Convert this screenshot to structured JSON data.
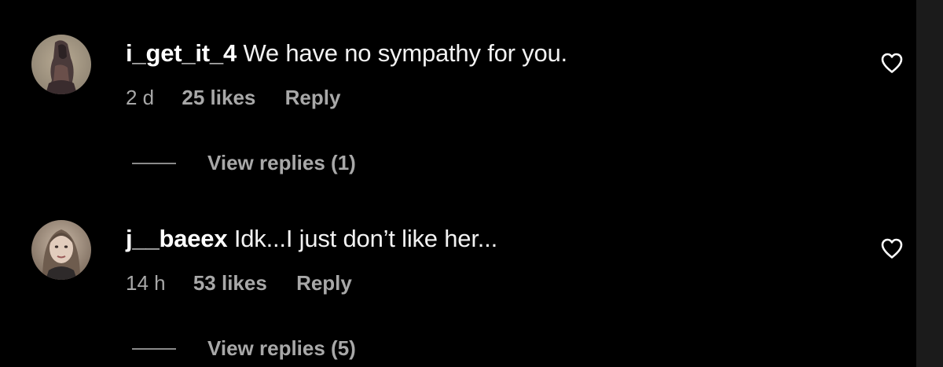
{
  "comments": [
    {
      "username": "i_get_it_4",
      "text": "We have no sympathy for you.",
      "age": "2 d",
      "likes": "25 likes",
      "reply_label": "Reply",
      "view_replies": "View replies (1)"
    },
    {
      "username": "j__baeex",
      "text": "Idk...I just don’t like her...",
      "age": "14 h",
      "likes": "53 likes",
      "reply_label": "Reply",
      "view_replies": "View replies (5)"
    }
  ],
  "icons": {
    "like": "heart-outline-icon"
  },
  "colors": {
    "background": "#000000",
    "primary_text": "#ffffff",
    "secondary_text": "#a8a8a8",
    "side_strip": "#1b1b1b"
  }
}
